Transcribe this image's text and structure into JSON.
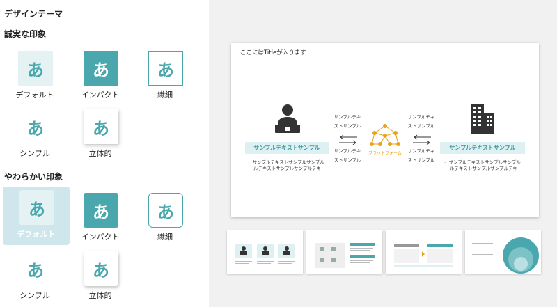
{
  "panel": {
    "title": "デザインテーマ",
    "sections": [
      {
        "title": "誠実な印象",
        "themes": [
          {
            "glyph": "あ",
            "label": "デフォルト"
          },
          {
            "glyph": "あ",
            "label": "インパクト"
          },
          {
            "glyph": "あ",
            "label": "繊細"
          },
          {
            "glyph": "あ",
            "label": "シンプル"
          },
          {
            "glyph": "あ",
            "label": "立体的"
          }
        ]
      },
      {
        "title": "やわらかい印象",
        "themes": [
          {
            "glyph": "あ",
            "label": "デフォルト"
          },
          {
            "glyph": "あ",
            "label": "インパクト"
          },
          {
            "glyph": "あ",
            "label": "繊細"
          },
          {
            "glyph": "あ",
            "label": "シンプル"
          },
          {
            "glyph": "あ",
            "label": "立体的"
          }
        ]
      }
    ],
    "selected": "やわらかい印象 / デフォルト"
  },
  "slide": {
    "title": "ここにはTitleが入ります",
    "left_label": "サンプルテキストサンプル",
    "left_bullet_line1": "・ サンプルテキストサンプルサンプル",
    "left_bullet_line2": "ルテキストサンプルサンプルテキ",
    "right_label": "サンプルテキストサンプル",
    "right_bullet_line1": "・ サンプルテキストサンプルサンプル",
    "right_bullet_line2": "ルテキストサンプルサンプルテキ",
    "mid_left_top": "サンプルテキ\nストサンプル",
    "mid_left_bottom": "サンプルテキ\nストサンプル",
    "mid_right_top": "サンプルテキ\nストサンプル",
    "mid_right_bottom": "サンプルテキ\nストサンプル",
    "platform": "プラットフォーム",
    "icons": {
      "left": "person-laptop-icon",
      "right": "building-icon",
      "center": "network-icon"
    }
  },
  "colors": {
    "accent": "#4aa7ad",
    "accent_light": "#e4f2f4",
    "selected_bg": "#cfe6ec",
    "platform": "#e8a317"
  }
}
